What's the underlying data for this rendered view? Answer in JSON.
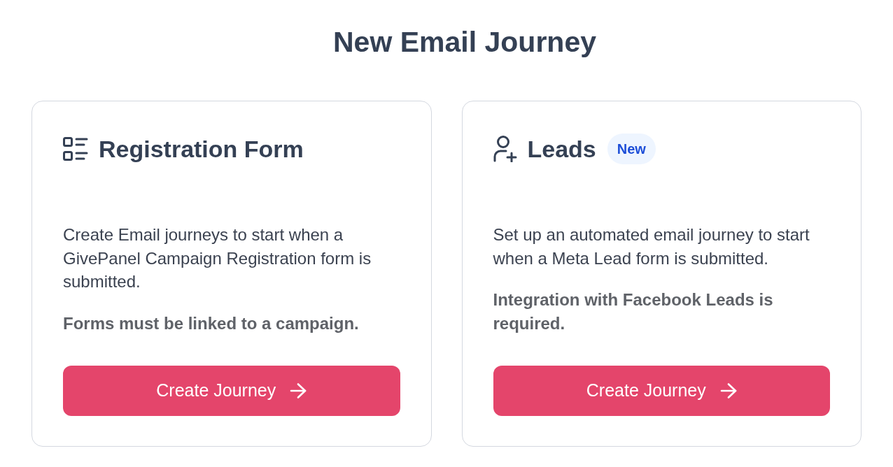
{
  "page": {
    "title": "New Email Journey"
  },
  "cards": [
    {
      "kind": "registration",
      "title": "Registration Form",
      "description": "Create Email journeys to start when a GivePanel Campaign Registration form is submitted.",
      "note": "Forms must be linked to a campaign.",
      "button": "Create Journey"
    },
    {
      "kind": "leads",
      "title": "Leads",
      "badge": "New",
      "description": "Set up an automated email journey to start when a Meta Lead form is submitted.",
      "note": "Integration with Facebook Leads is required.",
      "button": "Create Journey"
    }
  ]
}
